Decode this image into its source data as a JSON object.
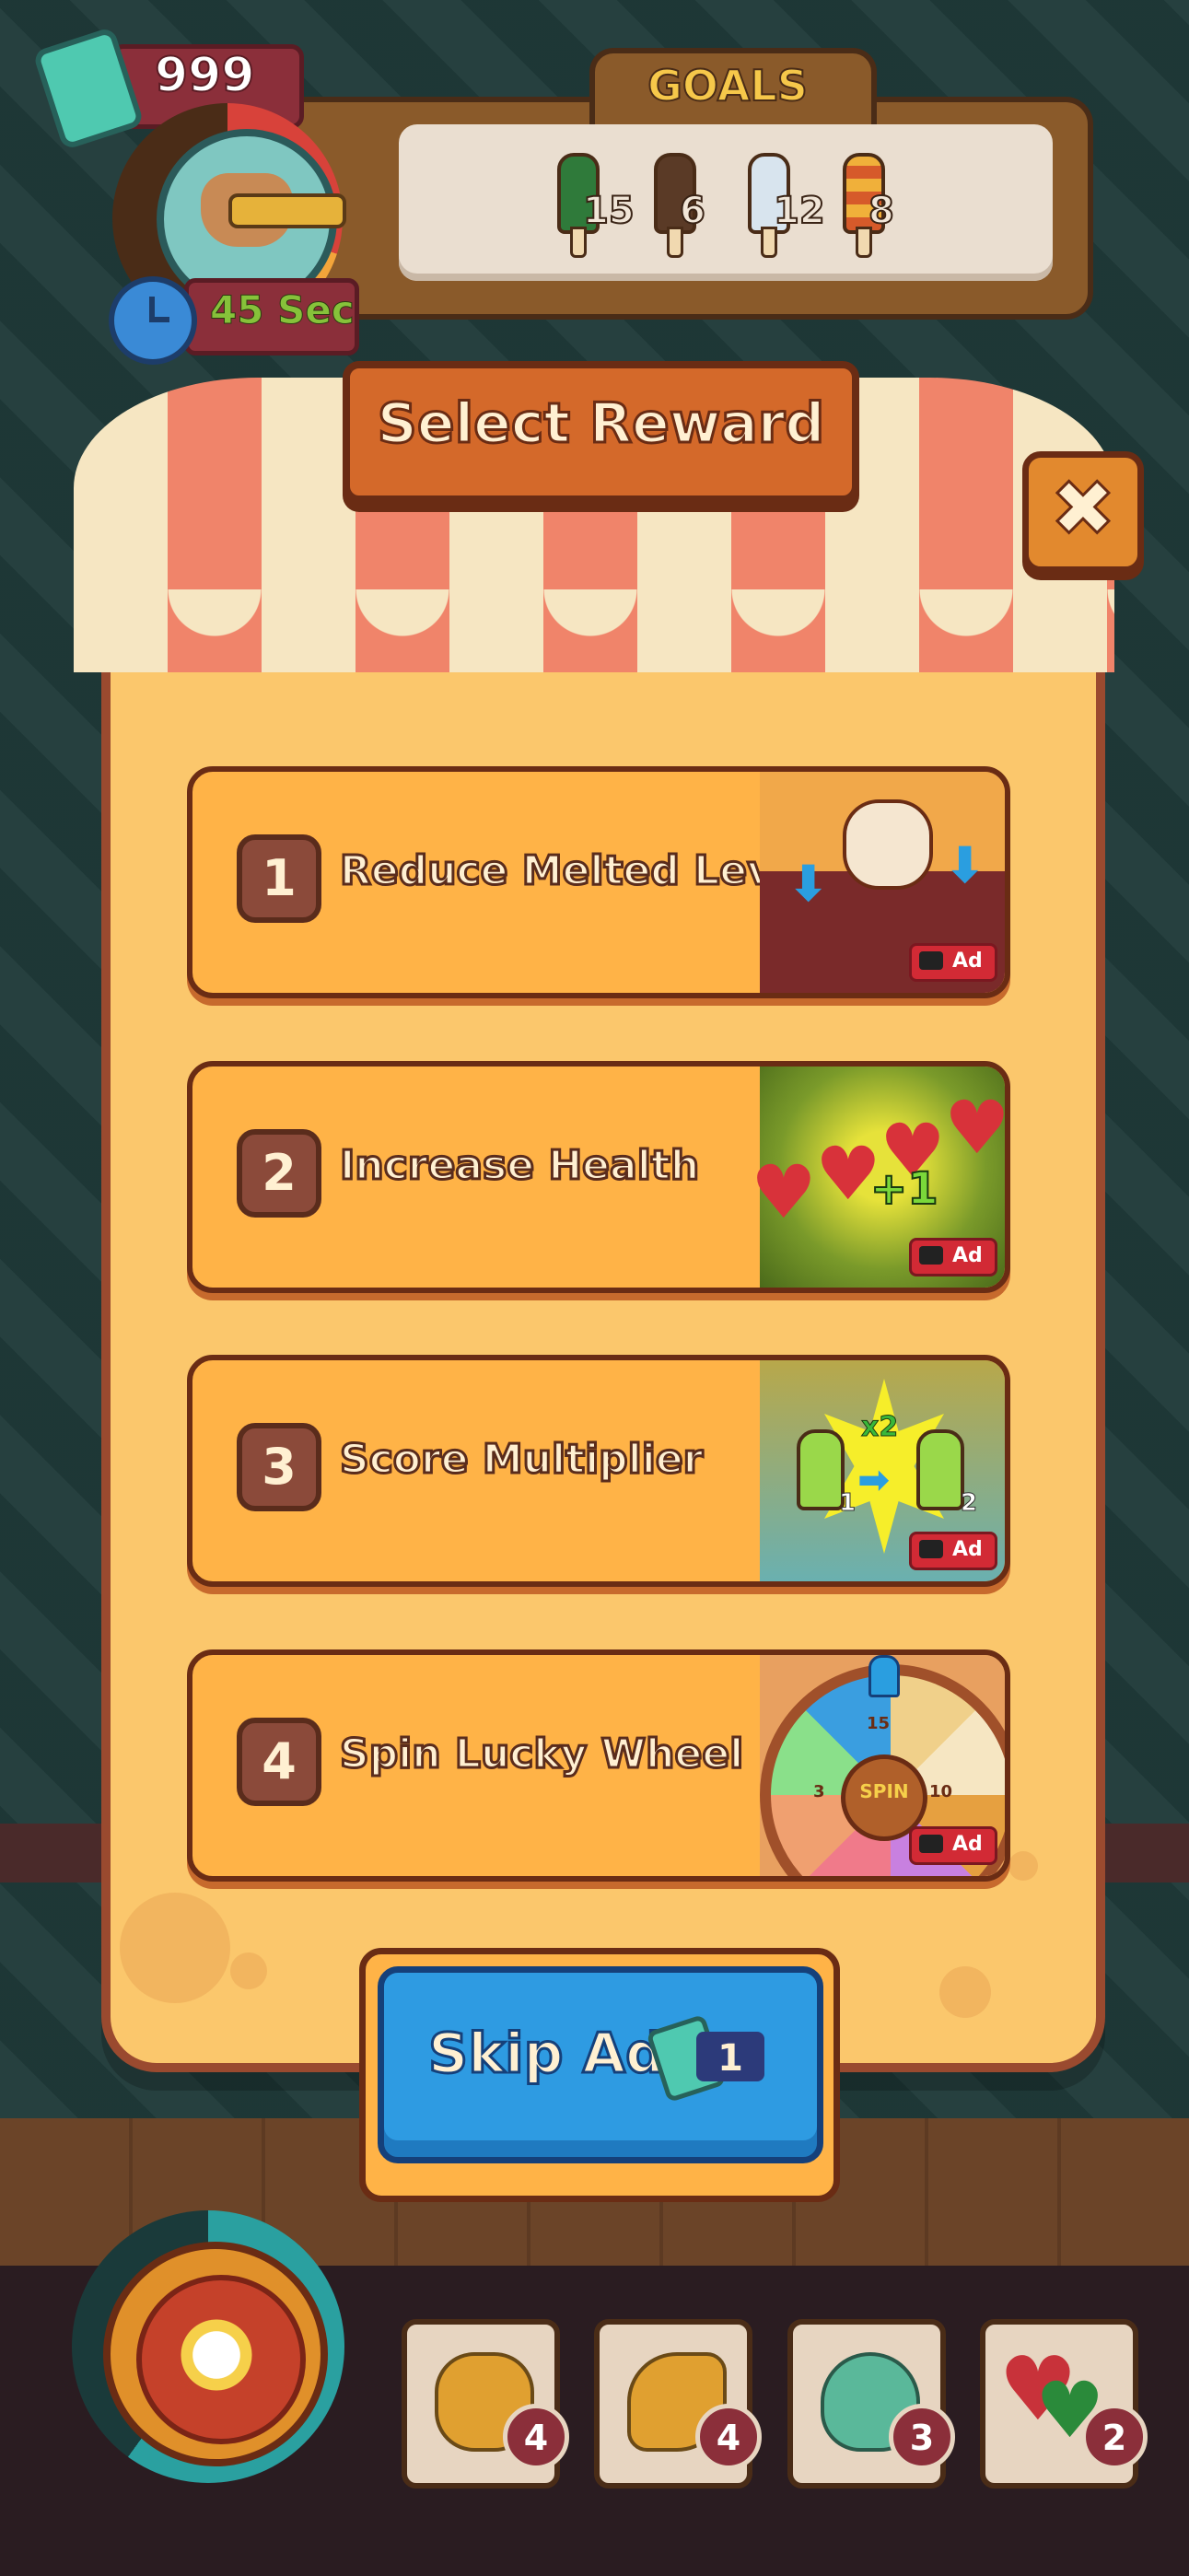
{
  "hud": {
    "tickets": "999",
    "timer": "45 Sec",
    "goals_title": "GOALS",
    "goals": [
      {
        "count": "15",
        "color": "#2f7a3a"
      },
      {
        "count": "6",
        "color": "#5a3a26"
      },
      {
        "count": "12",
        "color": "#d8e4ee"
      },
      {
        "count": "8",
        "color": "#d65a2a"
      }
    ]
  },
  "dialog": {
    "title": "Select Reward",
    "rewards": [
      {
        "number": "1",
        "label": "Reduce Melted Levels",
        "ad": "Ad"
      },
      {
        "number": "2",
        "label": "Increase Health",
        "ad": "Ad"
      },
      {
        "number": "3",
        "label": "Score Multiplier",
        "ad": "Ad"
      },
      {
        "number": "4",
        "label": "Spin Lucky Wheel",
        "ad": "Ad"
      }
    ],
    "skip_ads": {
      "label": "Skip Ads",
      "cost": "1"
    }
  },
  "thumb_text": {
    "health_plus": "+1",
    "mult": "x2",
    "mult_from": "1",
    "mult_to": "2",
    "wheel_center": "SPIN",
    "wheel_15": "15",
    "wheel_3": "3",
    "wheel_10": "10"
  },
  "inventory": [
    {
      "name": "paw",
      "count": "4",
      "color": "#e0a030"
    },
    {
      "name": "fish",
      "count": "4",
      "color": "#e0a030"
    },
    {
      "name": "potion",
      "count": "3",
      "color": "#5ab89a"
    },
    {
      "name": "hearts",
      "count": "2",
      "color": "#c8323a"
    }
  ]
}
